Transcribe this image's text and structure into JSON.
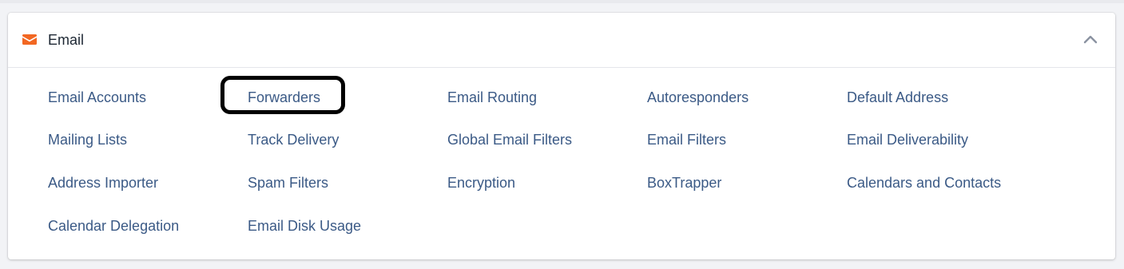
{
  "colors": {
    "accent": "#f26722",
    "link": "#3b5a86",
    "title": "#1d2733",
    "highlight": "#000000"
  },
  "section": {
    "title": "Email",
    "icon": "envelope-icon",
    "collapse_icon": "chevron-up-icon"
  },
  "links": [
    "Email Accounts",
    "Forwarders",
    "Email Routing",
    "Autoresponders",
    "Default Address",
    "Mailing Lists",
    "Track Delivery",
    "Global Email Filters",
    "Email Filters",
    "Email Deliverability",
    "Address Importer",
    "Spam Filters",
    "Encryption",
    "BoxTrapper",
    "Calendars and Contacts",
    "Calendar Delegation",
    "Email Disk Usage"
  ],
  "highlighted_link": "Forwarders"
}
